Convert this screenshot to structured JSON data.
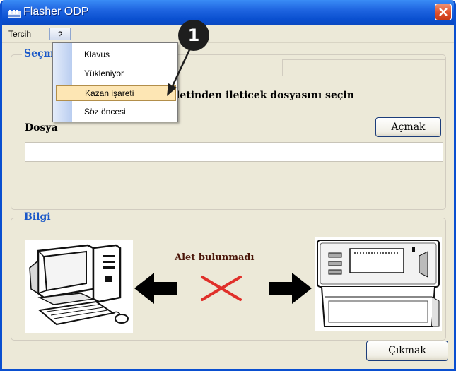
{
  "window": {
    "title": "Flasher ODP"
  },
  "menubar": {
    "items": [
      {
        "label": "Tercih"
      },
      {
        "label": "?"
      }
    ]
  },
  "dropdown": {
    "items": [
      {
        "label": "Klavus"
      },
      {
        "label": "Yükleniyor"
      },
      {
        "label": "Kazan işareti"
      },
      {
        "label": "Söz öncesi"
      }
    ],
    "highlighted_index": 2
  },
  "callout": {
    "number": "1"
  },
  "select_group": {
    "title": "Seçm",
    "instruction": "letinden ileticek dosyasını seçin",
    "file_label": "Dosya",
    "open_button": "Açmak",
    "file_path": ""
  },
  "info_group": {
    "title": "Bilgi",
    "alert": "Alet bulunmadı"
  },
  "exit_button": "Çıkmak",
  "colors": {
    "title_bar": "#0a50d0",
    "window_bg": "#ece9d8",
    "legend_text": "#1a58c8",
    "menu_highlight": "#fde6b4",
    "close_button": "#e0502c",
    "cross": "#e0302a"
  },
  "icons": {
    "app": "app-icon",
    "close": "close-icon",
    "computer": "computer-icon",
    "device": "device-icon",
    "cross": "cross-icon"
  }
}
